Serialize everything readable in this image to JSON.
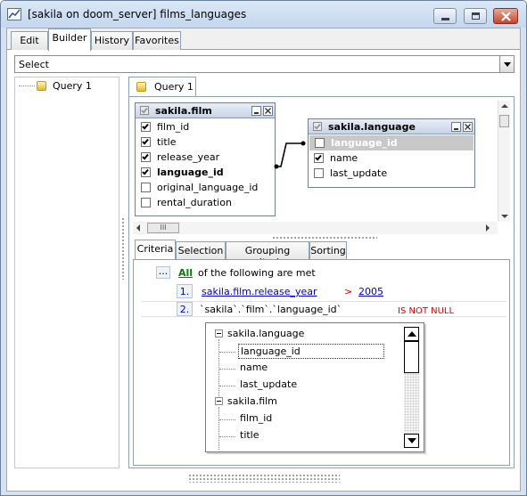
{
  "window": {
    "title": "[sakila on doom_server] films_languages"
  },
  "tabs": [
    {
      "label": "Edit"
    },
    {
      "label": "Builder"
    },
    {
      "label": "History"
    },
    {
      "label": "Favorites"
    }
  ],
  "statement_type": {
    "selected": "Select"
  },
  "query_tree": {
    "items": [
      {
        "label": "Query 1"
      }
    ]
  },
  "query_tab": {
    "label": "Query 1"
  },
  "tables": {
    "film": {
      "name": "sakila.film",
      "fields": [
        {
          "label": "film_id",
          "checked": true
        },
        {
          "label": "title",
          "checked": true
        },
        {
          "label": "release_year",
          "checked": true
        },
        {
          "label": "language_id",
          "checked": true
        },
        {
          "label": "original_language_id",
          "checked": false
        },
        {
          "label": "rental_duration",
          "checked": false
        }
      ]
    },
    "language": {
      "name": "sakila.language",
      "fields": [
        {
          "label": "language_id",
          "checked": false
        },
        {
          "label": "name",
          "checked": true
        },
        {
          "label": "last_update",
          "checked": false
        }
      ]
    }
  },
  "hscroll_thumb": "III",
  "criteria_tabs": [
    {
      "label": "Criteria"
    },
    {
      "label": "Selection"
    },
    {
      "label": "Grouping criteria"
    },
    {
      "label": "Sorting"
    }
  ],
  "criteria": {
    "dots_button": "...",
    "all_label": "All",
    "header_text": "of the following are met",
    "conditions": [
      {
        "num": "1.",
        "field": "sakila.film.release_year",
        "operator": ">",
        "value": "2005"
      },
      {
        "num": "2.",
        "field": "`sakila`.`film`.`language_id`",
        "operator": "IS NOT NULL",
        "value": ""
      }
    ]
  },
  "field_list": {
    "groups": [
      {
        "label": "sakila.language",
        "items": [
          "language_id",
          "name",
          "last_update"
        ]
      },
      {
        "label": "sakila.film",
        "items": [
          "film_id",
          "title"
        ]
      }
    ]
  },
  "colors": {
    "link": "#0000cc",
    "operator": "#e00000",
    "all_link": "#008000",
    "title_bar": "#c4d7ee"
  }
}
